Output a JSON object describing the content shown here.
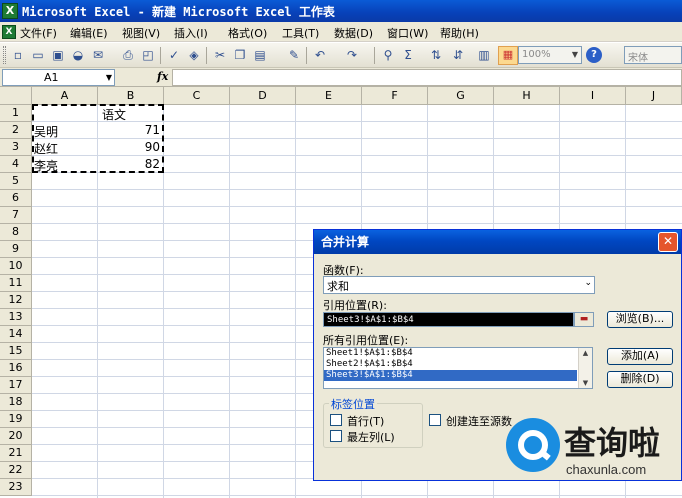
{
  "window": {
    "title": "Microsoft Excel - 新建 Microsoft Excel 工作表"
  },
  "menu": [
    "文件(F)",
    "编辑(E)",
    "视图(V)",
    "插入(I)",
    "格式(O)",
    "工具(T)",
    "数据(D)",
    "窗口(W)",
    "帮助(H)"
  ],
  "toolbar": {
    "zoom": "100%",
    "font": "宋体"
  },
  "formula_bar": {
    "name_box": "A1",
    "fx": "fx",
    "formula": ""
  },
  "columns": [
    "A",
    "B",
    "C",
    "D",
    "E",
    "F",
    "G",
    "H",
    "I",
    "J"
  ],
  "rows": [
    "1",
    "2",
    "3",
    "4",
    "5",
    "6",
    "7",
    "8",
    "9",
    "10",
    "11",
    "12",
    "13",
    "14",
    "15",
    "16",
    "17",
    "18",
    "19",
    "20",
    "21",
    "22",
    "23"
  ],
  "cells": {
    "B1": "语文",
    "A2": "吴明",
    "B2": "71",
    "A3": "赵红",
    "B3": "90",
    "A4": "李亮",
    "B4": "82"
  },
  "dialog": {
    "title": "合并计算",
    "function_label": "函数(F):",
    "function_value": "求和",
    "ref_label": "引用位置(R):",
    "ref_value": "Sheet3!$A$1:$B$4",
    "browse": "浏览(B)...",
    "all_refs_label": "所有引用位置(E):",
    "all_refs": [
      "Sheet1!$A$1:$B$4",
      "Sheet2!$A$1:$B$4",
      "Sheet3!$A$1:$B$4"
    ],
    "add": "添加(A)",
    "delete": "删除(D)",
    "label_pos": "标签位置",
    "first_row": "首行(T)",
    "left_col": "最左列(L)",
    "link_source": "创建连至源数"
  },
  "watermark": {
    "cn": "查询啦",
    "en": "chaxunla.com"
  }
}
